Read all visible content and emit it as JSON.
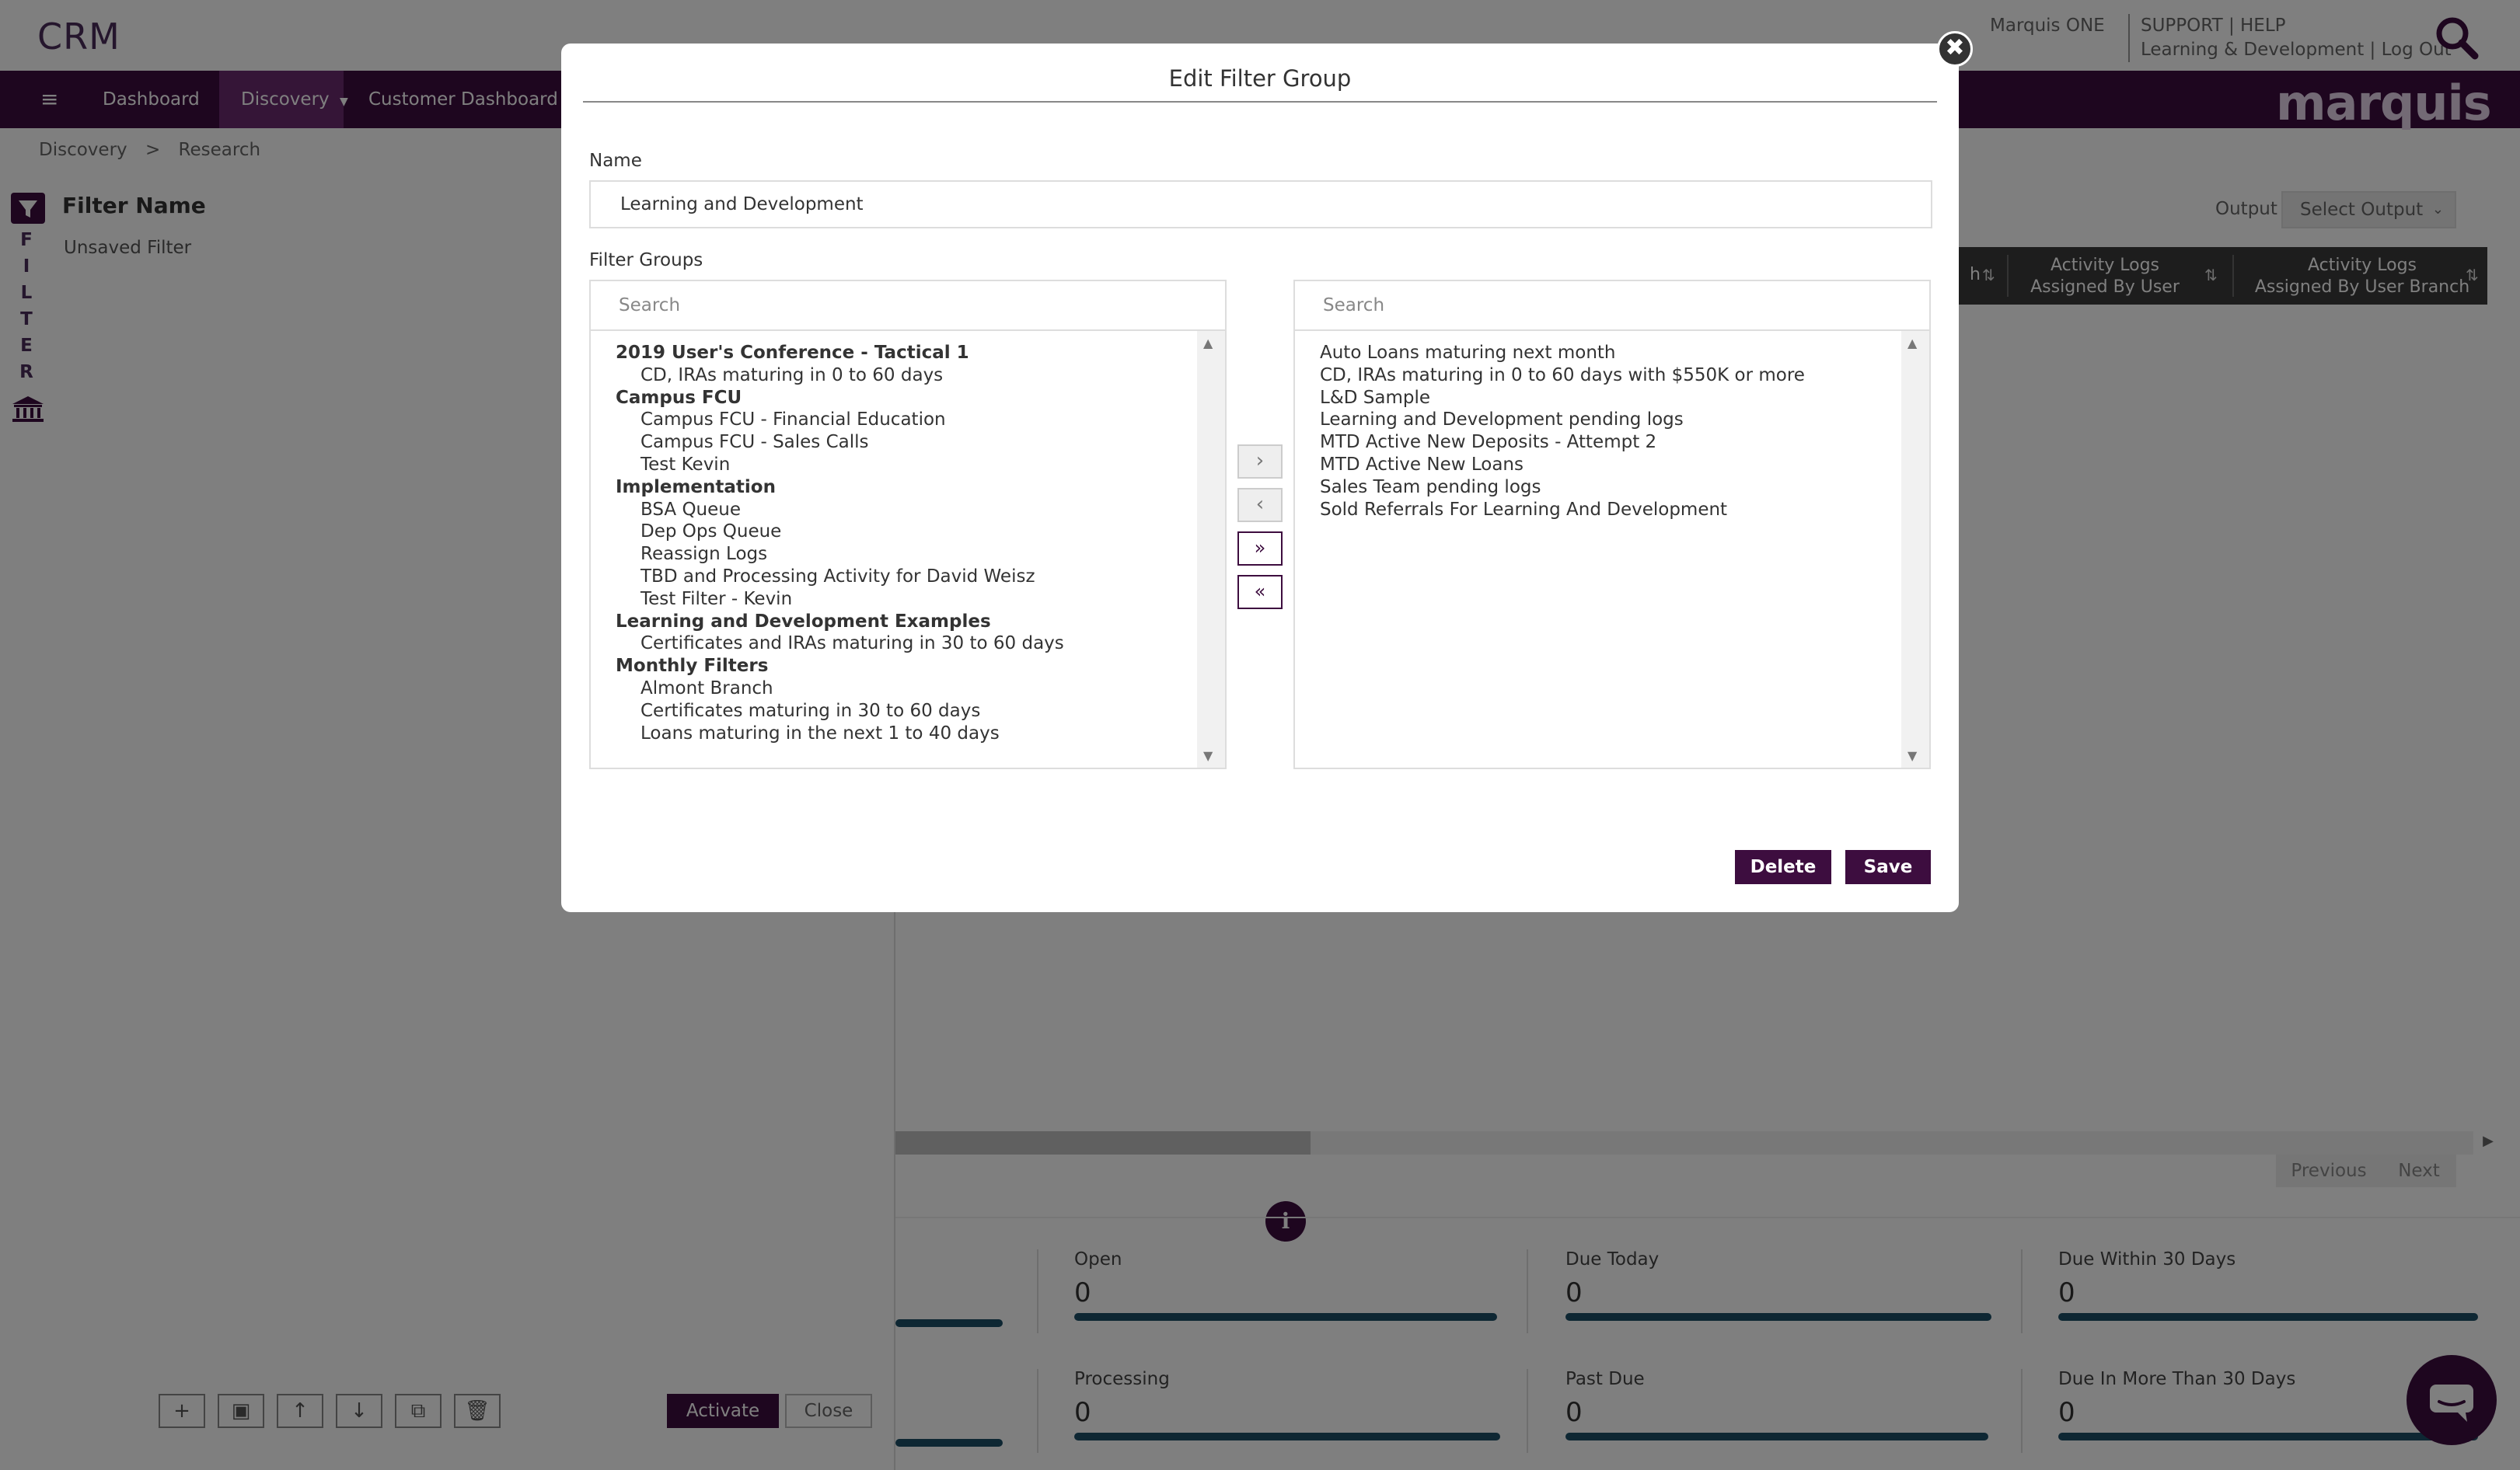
{
  "header": {
    "app_name": "CRM",
    "org": "Marquis ONE",
    "links_top": "SUPPORT | HELP",
    "links_bottom": "Learning & Development | Log Out",
    "brand": "marquis"
  },
  "nav": {
    "menu_icon": "≡",
    "items": [
      {
        "label": "Dashboard"
      },
      {
        "label": "Discovery"
      },
      {
        "label": "Customer Dashboard"
      }
    ]
  },
  "breadcrumb": {
    "parts": [
      "Discovery",
      ">",
      "Research"
    ]
  },
  "left_panel": {
    "title": "Filter Name",
    "vertical_label": [
      "F",
      "I",
      "L",
      "T",
      "E",
      "R"
    ],
    "current_filter": "Unsaved Filter",
    "activate": "Activate",
    "close": "Close"
  },
  "results": {
    "output_label": "Output",
    "output_placeholder": "Select Output",
    "columns": [
      {
        "line1": "Activity Logs",
        "line2": "Assigned By User"
      },
      {
        "line1": "Activity Logs",
        "line2": "Assigned By User Branch"
      }
    ],
    "partial_column": "h",
    "previous": "Previous",
    "next": "Next"
  },
  "stats": [
    {
      "label": "Open",
      "value": "0"
    },
    {
      "label": "Due Today",
      "value": "0"
    },
    {
      "label": "Due Within 30 Days",
      "value": "0"
    },
    {
      "label": "Processing",
      "value": "0"
    },
    {
      "label": "Past Due",
      "value": "0"
    },
    {
      "label": "Due In More Than 30 Days",
      "value": "0"
    }
  ],
  "modal": {
    "title": "Edit Filter Group",
    "close_glyph": "✖",
    "name_label": "Name",
    "name_value": "Learning and Development",
    "groups_label": "Filter Groups",
    "available_search_placeholder": "Search",
    "selected_search_placeholder": "Search",
    "available": [
      {
        "label": "2019 User's Conference - Tactical 1",
        "group": true
      },
      {
        "label": "CD, IRAs maturing in 0 to 60 days",
        "group": false
      },
      {
        "label": "Campus FCU",
        "group": true
      },
      {
        "label": "Campus FCU - Financial Education",
        "group": false
      },
      {
        "label": "Campus FCU - Sales Calls",
        "group": false
      },
      {
        "label": "Test Kevin",
        "group": false
      },
      {
        "label": "Implementation",
        "group": true
      },
      {
        "label": "BSA Queue",
        "group": false
      },
      {
        "label": "Dep Ops Queue",
        "group": false
      },
      {
        "label": "Reassign Logs",
        "group": false
      },
      {
        "label": "TBD and Processing Activity for David Weisz",
        "group": false
      },
      {
        "label": "Test Filter - Kevin",
        "group": false
      },
      {
        "label": "Learning and Development Examples",
        "group": true
      },
      {
        "label": "Certificates and IRAs maturing in 30 to 60 days",
        "group": false
      },
      {
        "label": "Monthly Filters",
        "group": true
      },
      {
        "label": "Almont Branch",
        "group": false
      },
      {
        "label": "Certificates maturing in 30 to 60 days",
        "group": false
      },
      {
        "label": "Loans maturing in the next 1 to 40 days",
        "group": false
      }
    ],
    "selected": [
      "Auto Loans maturing next month",
      "CD, IRAs maturing in 0 to 60 days with $550K or more",
      "L&D Sample",
      "Learning and Development pending logs",
      "MTD Active New Deposits - Attempt 2",
      "MTD Active New Loans",
      "Sales Team pending logs",
      "Sold Referrals For Learning And Development"
    ],
    "move_buttons": {
      "right": "›",
      "left": "‹",
      "all_right": "»",
      "all_left": "«"
    },
    "delete": "Delete",
    "save": "Save"
  },
  "colors": {
    "brand_purple": "#3d0d3f",
    "bar_teal": "#1d4f66"
  }
}
